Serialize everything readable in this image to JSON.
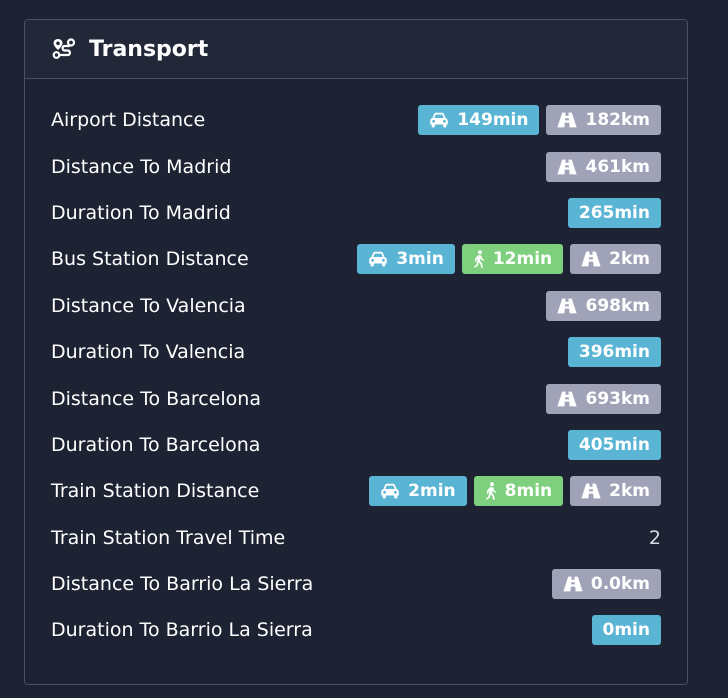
{
  "header": {
    "title": "Transport",
    "icon": "route-icon"
  },
  "colors": {
    "car": "#5ab4d4",
    "walk": "#7ed07e",
    "road": "#a0a3b8",
    "background": "#1e2333"
  },
  "rows": [
    {
      "label": "Airport Distance",
      "car": "149min",
      "road": "182km"
    },
    {
      "label": "Distance To Madrid",
      "road": "461km"
    },
    {
      "label": "Duration To Madrid",
      "time": "265min"
    },
    {
      "label": "Bus Station Distance",
      "car": "3min",
      "walk": "12min",
      "road": "2km"
    },
    {
      "label": "Distance To Valencia",
      "road": "698km"
    },
    {
      "label": "Duration To Valencia",
      "time": "396min"
    },
    {
      "label": "Distance To Barcelona",
      "road": "693km"
    },
    {
      "label": "Duration To Barcelona",
      "time": "405min"
    },
    {
      "label": "Train Station Distance",
      "car": "2min",
      "walk": "8min",
      "road": "2km"
    },
    {
      "label": "Train Station Travel Time",
      "plain": "2"
    },
    {
      "label": "Distance To Barrio La Sierra",
      "road": "0.0km"
    },
    {
      "label": "Duration To Barrio La Sierra",
      "time": "0min"
    }
  ]
}
